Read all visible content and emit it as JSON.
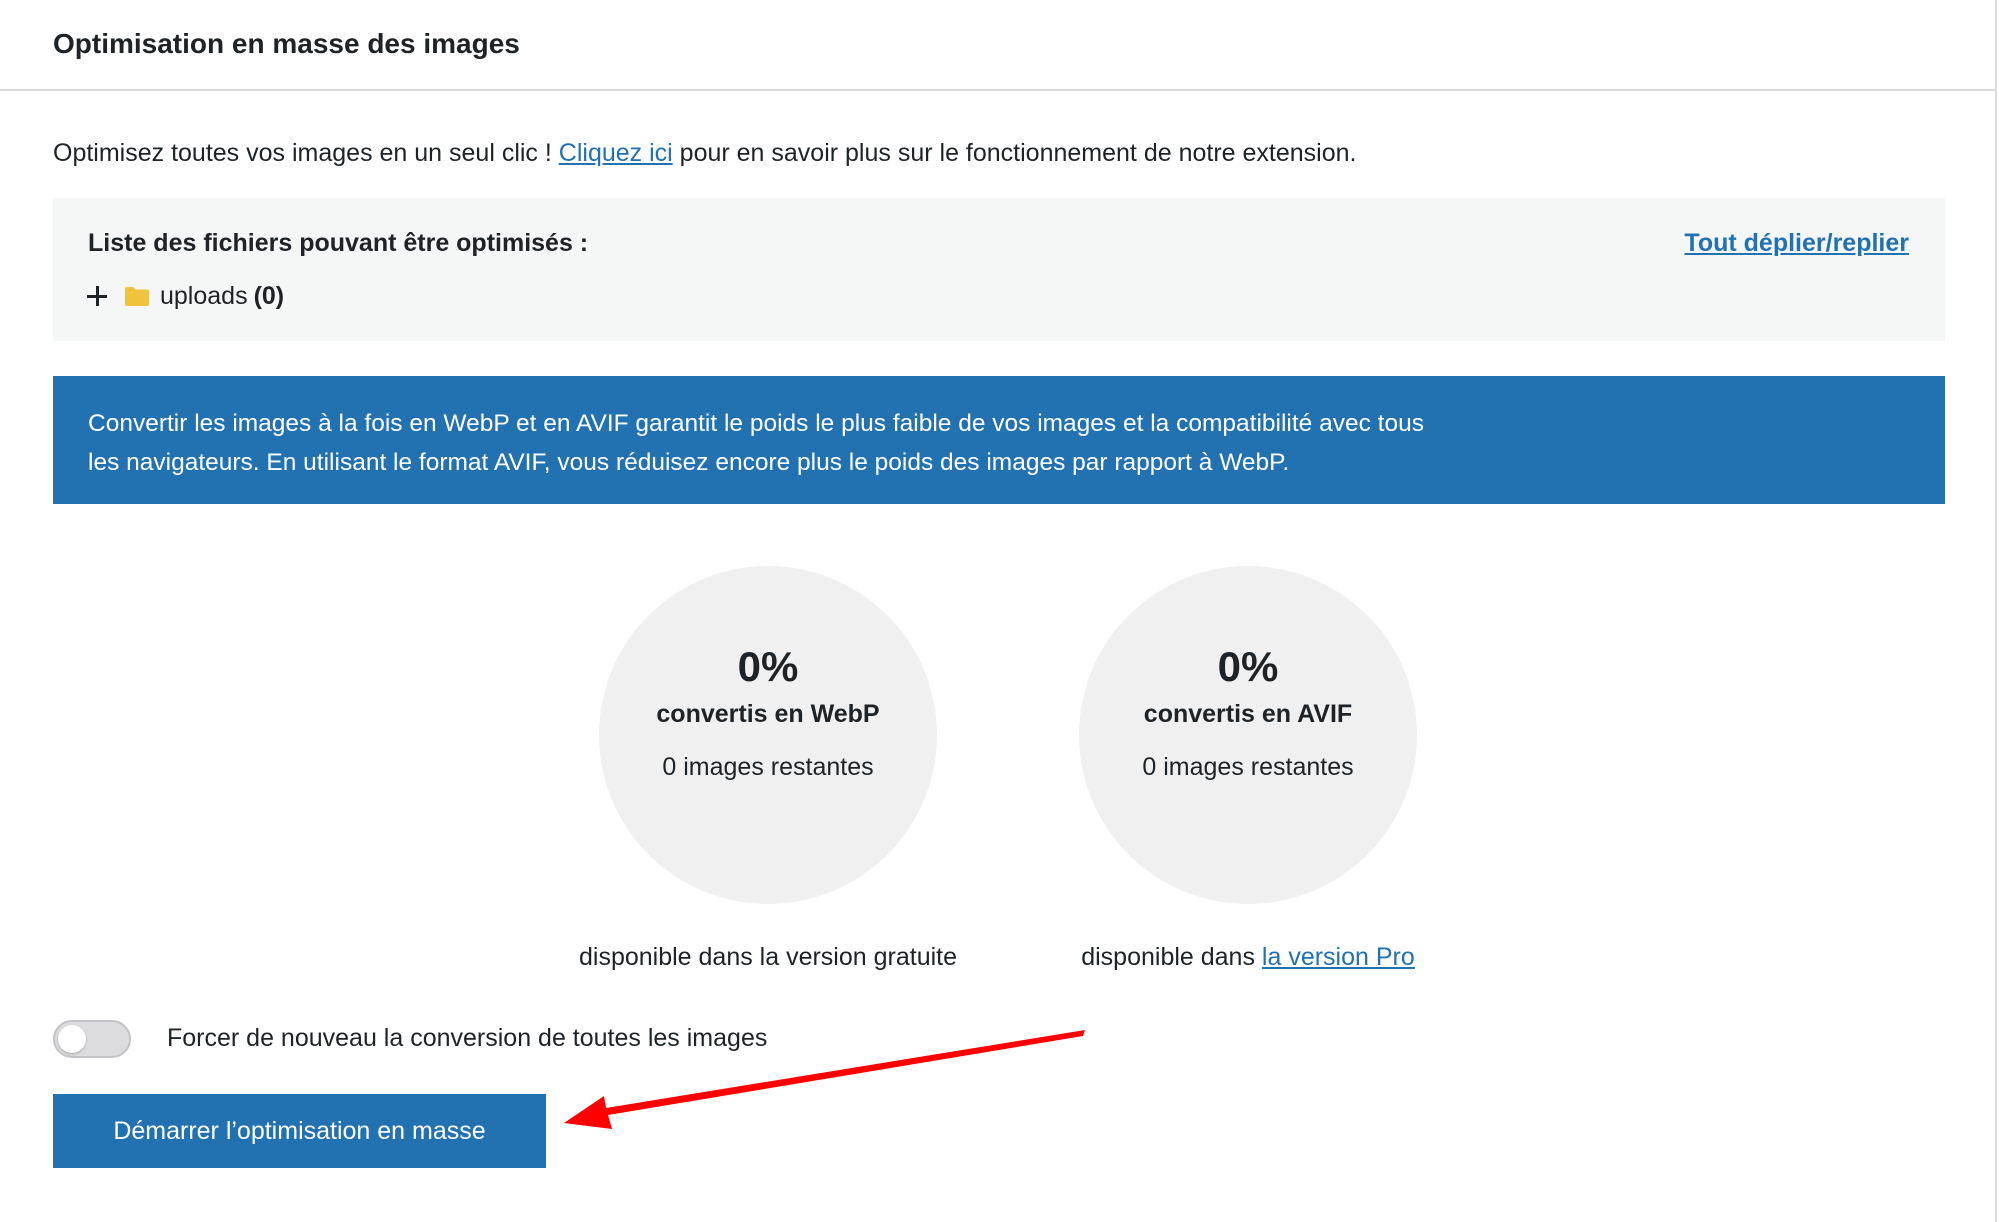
{
  "header": {
    "title": "Optimisation en masse des images"
  },
  "intro": {
    "before_link": "Optimisez toutes vos images en un seul clic ! ",
    "link_text": "Cliquez ici",
    "after_link": " pour en savoir plus sur le fonctionnement de notre extension."
  },
  "files": {
    "title": "Liste des fichiers pouvant être optimisés :",
    "toggle_all": "Tout déplier/replier",
    "folders": [
      {
        "name": "uploads",
        "count": "(0)"
      }
    ]
  },
  "notice": {
    "line1": "Convertir les images à la fois en WebP et en AVIF garantit le poids le plus faible de vos images et la compatibilité avec tous",
    "line2": "les navigateurs. En utilisant le format AVIF, vous réduisez encore plus le poids des images par rapport à WebP."
  },
  "stats": {
    "webp": {
      "percent": "0%",
      "label": "convertis en WebP",
      "remaining": "0 images restantes",
      "availability": "disponible dans la version gratuite"
    },
    "avif": {
      "percent": "0%",
      "label": "convertis en AVIF",
      "remaining": "0 images restantes",
      "availability_prefix": "disponible dans ",
      "availability_link": "la version Pro"
    }
  },
  "force": {
    "label": "Forcer de nouveau la conversion de toutes les images",
    "enabled": false
  },
  "start_button": {
    "label": "Démarrer l’optimisation en masse"
  },
  "colors": {
    "accent": "#2271b1",
    "folder": "#f0c33c",
    "arrow": "#ff0000",
    "circle_bg": "#f0f0f1"
  },
  "icons": {
    "expand": "plus-icon",
    "folder": "folder-icon",
    "annotation": "arrow-annotation"
  }
}
